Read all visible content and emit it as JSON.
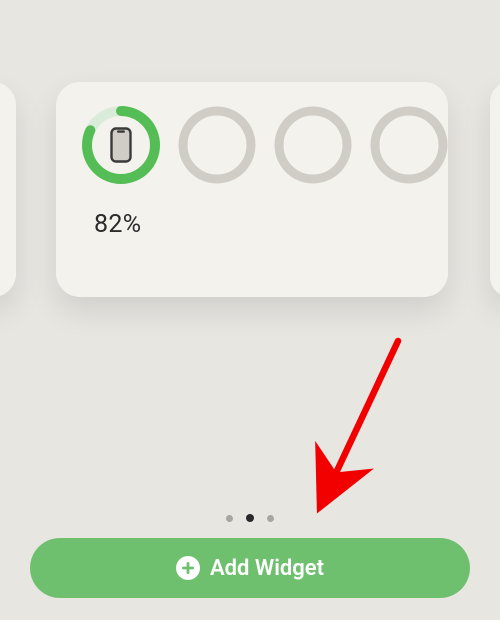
{
  "widget": {
    "battery": {
      "percent": 82,
      "percent_label": "82%"
    },
    "rings": {
      "active_count": 1,
      "total": 4
    }
  },
  "pagination": {
    "total": 3,
    "active_index": 1
  },
  "button": {
    "add_widget_label": "Add Widget"
  },
  "colors": {
    "accent_green": "#6ec06e",
    "ring_active": "#55bd55",
    "ring_inactive": "#cfcdc6",
    "card_bg": "#f4f2ed",
    "page_bg": "#e8e6e1",
    "arrow_red": "#f20000"
  }
}
